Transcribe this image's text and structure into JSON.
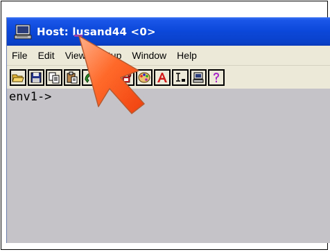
{
  "window": {
    "title": "Host: lusand44 <0>",
    "title_icon": "terminal-monitor-icon"
  },
  "menu": {
    "items": [
      {
        "label": "File"
      },
      {
        "label": "Edit"
      },
      {
        "label": "View"
      },
      {
        "label": "Setup"
      },
      {
        "label": "Window"
      },
      {
        "label": "Help"
      }
    ]
  },
  "toolbar": {
    "buttons": [
      {
        "icon": "open-folder-icon"
      },
      {
        "icon": "save-icon"
      },
      {
        "icon": "copy-icon"
      },
      {
        "icon": "paste-icon"
      },
      {
        "icon": "connect-phone-icon"
      },
      {
        "icon": "disconnect-icon"
      },
      {
        "icon": "dial-phone-icon"
      },
      {
        "icon": "color-palette-icon"
      },
      {
        "icon": "font-icon"
      },
      {
        "icon": "cursor-icon"
      },
      {
        "icon": "computer-icon"
      },
      {
        "icon": "help-icon"
      }
    ]
  },
  "terminal": {
    "prompt": "env1->"
  },
  "colors": {
    "title_bar": "#0b47d8",
    "terminal_bg": "#c5c3c8",
    "menu_bg": "#ece9d8",
    "pointer_arrow": "#ff5a1f"
  }
}
